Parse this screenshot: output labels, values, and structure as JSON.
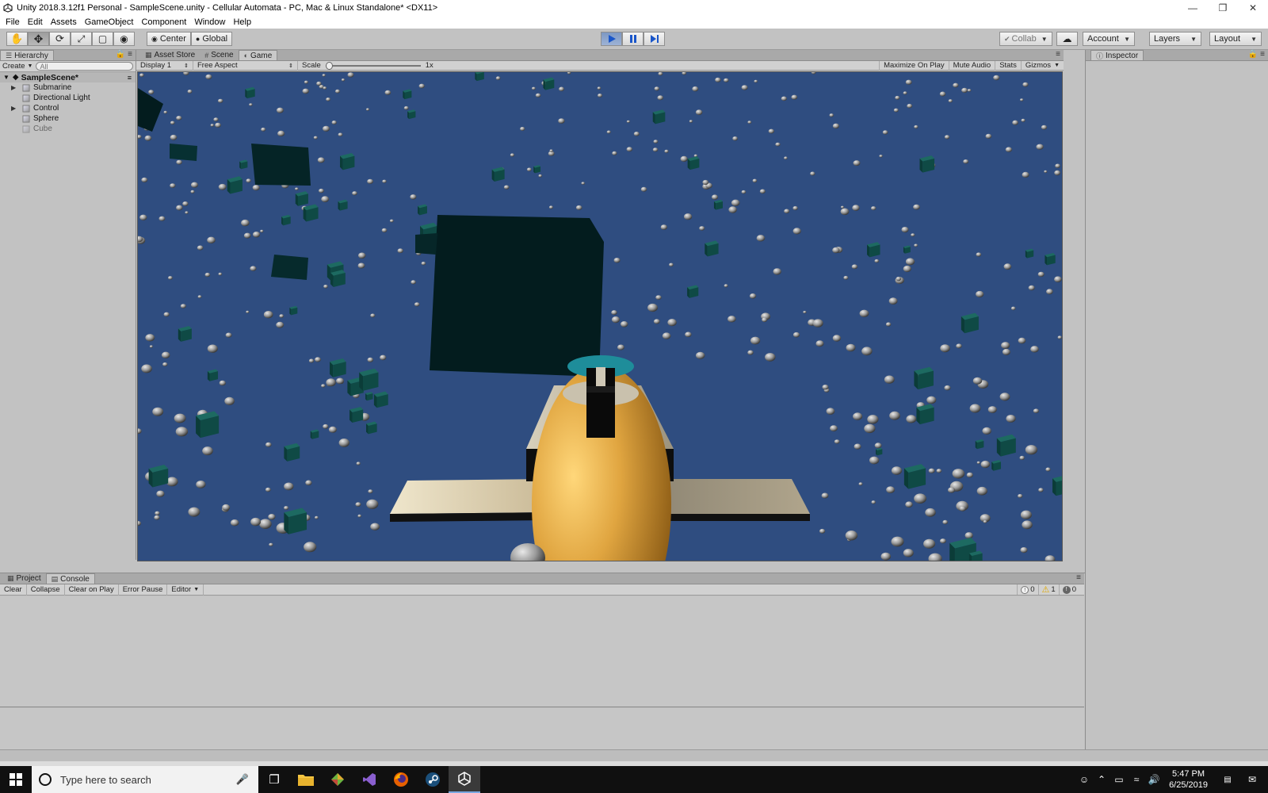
{
  "window": {
    "title": "Unity 2018.3.12f1 Personal - SampleScene.unity - Cellular Automata - PC, Mac & Linux Standalone* <DX11>"
  },
  "menu": [
    "File",
    "Edit",
    "Assets",
    "GameObject",
    "Component",
    "Window",
    "Help"
  ],
  "toolbar": {
    "pivot_label": "Center",
    "space_label": "Global",
    "collab_label": "Collab",
    "account_label": "Account",
    "layers_label": "Layers",
    "layout_label": "Layout",
    "play_active": true
  },
  "hierarchy": {
    "tab_label": "Hierarchy",
    "create_label": "Create",
    "search_placeholder": "All",
    "scene_name": "SampleScene*",
    "items": [
      {
        "label": "Submarine",
        "expandable": true
      },
      {
        "label": "Directional Light",
        "expandable": false
      },
      {
        "label": "Control",
        "expandable": true
      },
      {
        "label": "Sphere",
        "expandable": false
      },
      {
        "label": "Cube",
        "expandable": false
      }
    ]
  },
  "center_tabs": [
    {
      "label": "Asset Store",
      "active": false
    },
    {
      "label": "Scene",
      "active": false
    },
    {
      "label": "Game",
      "active": true
    }
  ],
  "game_toolbar": {
    "display": "Display 1",
    "aspect": "Free Aspect",
    "scale_label": "Scale",
    "scale_value": "1x",
    "maximize": "Maximize On Play",
    "mute": "Mute Audio",
    "stats": "Stats",
    "gizmos": "Gizmos"
  },
  "inspector": {
    "tab_label": "Inspector"
  },
  "bottom_tabs": [
    {
      "label": "Project",
      "active": false
    },
    {
      "label": "Console",
      "active": true
    }
  ],
  "console": {
    "clear": "Clear",
    "collapse": "Collapse",
    "clear_on_play": "Clear on Play",
    "error_pause": "Error Pause",
    "editor": "Editor",
    "log_count": "0",
    "warning_count": "1",
    "error_count": "0"
  },
  "taskbar": {
    "search_placeholder": "Type here to search",
    "time": "5:47 PM",
    "date": "6/25/2019"
  },
  "colors": {
    "game_background": "#2f4d80",
    "play_active": "#7d97c2"
  }
}
